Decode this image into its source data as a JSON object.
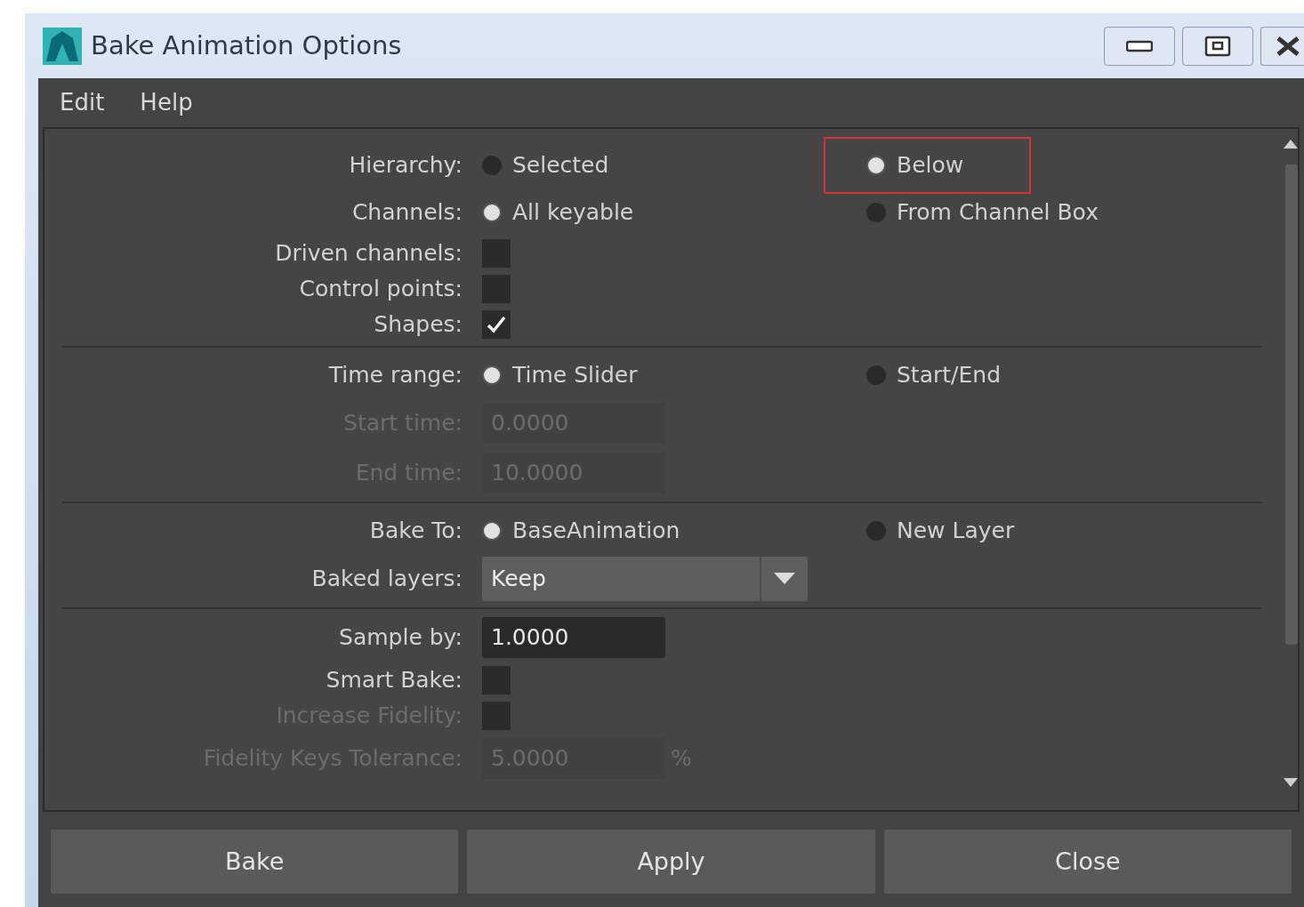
{
  "window": {
    "title": "Bake Animation Options"
  },
  "menu": [
    "Edit",
    "Help"
  ],
  "sections": [
    {
      "rows": [
        {
          "kind": "radio",
          "label": "Hierarchy:",
          "disabled": false,
          "options": [
            {
              "label": "Selected",
              "selected": false,
              "highlighted": false
            },
            {
              "label": "Below",
              "selected": true,
              "highlighted": true
            }
          ]
        },
        {
          "kind": "radio",
          "label": "Channels:",
          "disabled": false,
          "options": [
            {
              "label": "All keyable",
              "selected": true,
              "highlighted": false
            },
            {
              "label": "From Channel Box",
              "selected": false,
              "highlighted": false
            }
          ]
        },
        {
          "kind": "checkbox",
          "label": "Driven channels:",
          "disabled": false,
          "checked": false
        },
        {
          "kind": "checkbox",
          "label": "Control points:",
          "disabled": false,
          "checked": false
        },
        {
          "kind": "checkbox",
          "label": "Shapes:",
          "disabled": false,
          "checked": true
        }
      ]
    },
    {
      "rows": [
        {
          "kind": "radio",
          "label": "Time range:",
          "disabled": false,
          "options": [
            {
              "label": "Time Slider",
              "selected": true,
              "highlighted": false
            },
            {
              "label": "Start/End",
              "selected": false,
              "highlighted": false
            }
          ]
        },
        {
          "kind": "field",
          "label": "Start time:",
          "disabled": true,
          "value": "0.0000"
        },
        {
          "kind": "field",
          "label": "End time:",
          "disabled": true,
          "value": "10.0000"
        }
      ]
    },
    {
      "rows": [
        {
          "kind": "radio",
          "label": "Bake To:",
          "disabled": false,
          "options": [
            {
              "label": "BaseAnimation",
              "selected": true,
              "highlighted": false
            },
            {
              "label": "New Layer",
              "selected": false,
              "highlighted": false
            }
          ]
        },
        {
          "kind": "dropdown",
          "label": "Baked layers:",
          "disabled": false,
          "value": "Keep"
        }
      ]
    },
    {
      "rows": [
        {
          "kind": "field",
          "label": "Sample by:",
          "disabled": false,
          "value": "1.0000"
        },
        {
          "kind": "checkbox",
          "label": "Smart Bake:",
          "disabled": false,
          "checked": false
        },
        {
          "kind": "checkbox",
          "label": "Increase Fidelity:",
          "disabled": true,
          "checked": false
        },
        {
          "kind": "field",
          "label": "Fidelity Keys Tolerance:",
          "disabled": true,
          "value": "5.0000",
          "suffix": "%"
        }
      ]
    }
  ],
  "buttons": [
    "Bake",
    "Apply",
    "Close"
  ]
}
